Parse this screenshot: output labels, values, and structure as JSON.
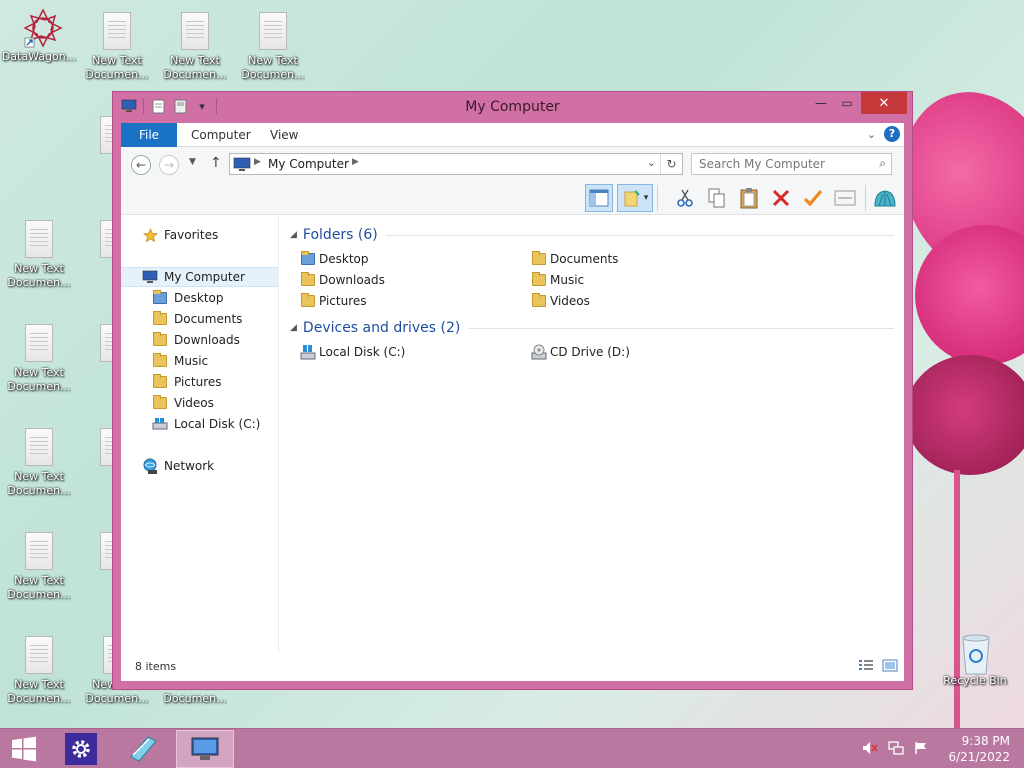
{
  "desktop": {
    "icons": [
      {
        "label": "DataWagon..."
      },
      {
        "label": "New Text Documen..."
      },
      {
        "label": "New Text Documen..."
      },
      {
        "label": "New Text Documen..."
      },
      {
        "label": "New Text Documen..."
      },
      {
        "label": "New Text Documen..."
      },
      {
        "label": "New Text Documen..."
      },
      {
        "label": "New Text Documen..."
      },
      {
        "label": "New Text Documen..."
      },
      {
        "label": "New Text Documen..."
      },
      {
        "label": "New Text Documen..."
      },
      {
        "label": "Recycle Bin"
      }
    ]
  },
  "window": {
    "title": "My Computer",
    "ribbon_tabs": {
      "file": "File",
      "computer": "Computer",
      "view": "View"
    },
    "address": {
      "path": "My Computer"
    },
    "search": {
      "placeholder": "Search My Computer"
    },
    "nav": {
      "favorites": "Favorites",
      "my_computer": "My Computer",
      "children": [
        "Desktop",
        "Documents",
        "Downloads",
        "Music",
        "Pictures",
        "Videos",
        "Local Disk (C:)"
      ],
      "network": "Network"
    },
    "content": {
      "folders_header": "Folders (6)",
      "folders": [
        "Desktop",
        "Documents",
        "Downloads",
        "Music",
        "Pictures",
        "Videos"
      ],
      "drives_header": "Devices and drives (2)",
      "drives": [
        "Local Disk (C:)",
        "CD Drive (D:)"
      ]
    },
    "status": {
      "count": "8 items"
    }
  },
  "taskbar": {
    "time": "9:38 PM",
    "date": "6/21/2022"
  },
  "colors": {
    "window_frame": "#d070a4",
    "taskbar": "#b978a0",
    "file_tab": "#1a72c4",
    "close_button": "#c7383a",
    "group_header": "#1e4f9e"
  }
}
